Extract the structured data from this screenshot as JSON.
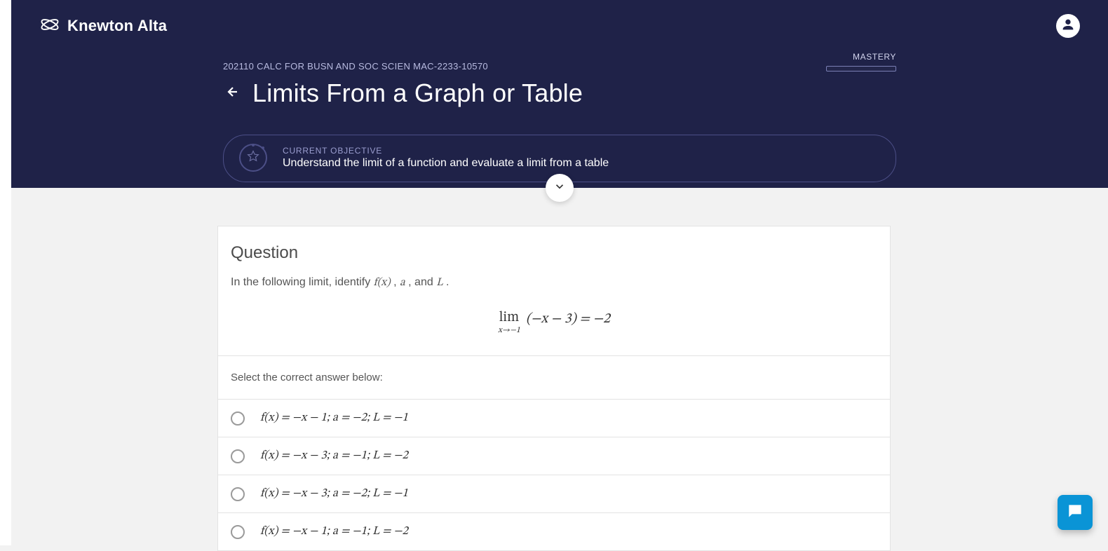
{
  "brand": {
    "name": "Knewton Alta"
  },
  "course": {
    "code": "202110 CALC FOR BUSN AND SOC SCIEN MAC-2233-10570"
  },
  "mastery": {
    "label": "MASTERY"
  },
  "page": {
    "title": "Limits From a Graph or Table"
  },
  "objective": {
    "caption": "CURRENT OBJECTIVE",
    "description": "Understand the limit of a function and evaluate a limit from a table"
  },
  "question": {
    "heading": "Question",
    "prompt_prefix": "In the following limit, identify ",
    "prompt_math1": "f(x)",
    "prompt_mid1": ", ",
    "prompt_math2": "a",
    "prompt_mid2": ", and ",
    "prompt_math3": "L",
    "prompt_suffix": ".",
    "limit": {
      "lim": "lim",
      "sub": "x→−1",
      "body": "(−x − 3) = −2"
    },
    "select_label": "Select the correct answer below:",
    "options": [
      {
        "text": "f(x) = −x − 1; a = −2; L = −1"
      },
      {
        "text": "f(x) = −x − 3; a = −1; L = −2"
      },
      {
        "text": "f(x) = −x − 3; a = −2; L = −1"
      },
      {
        "text": "f(x) = −x − 1; a = −1; L = −2"
      }
    ]
  }
}
